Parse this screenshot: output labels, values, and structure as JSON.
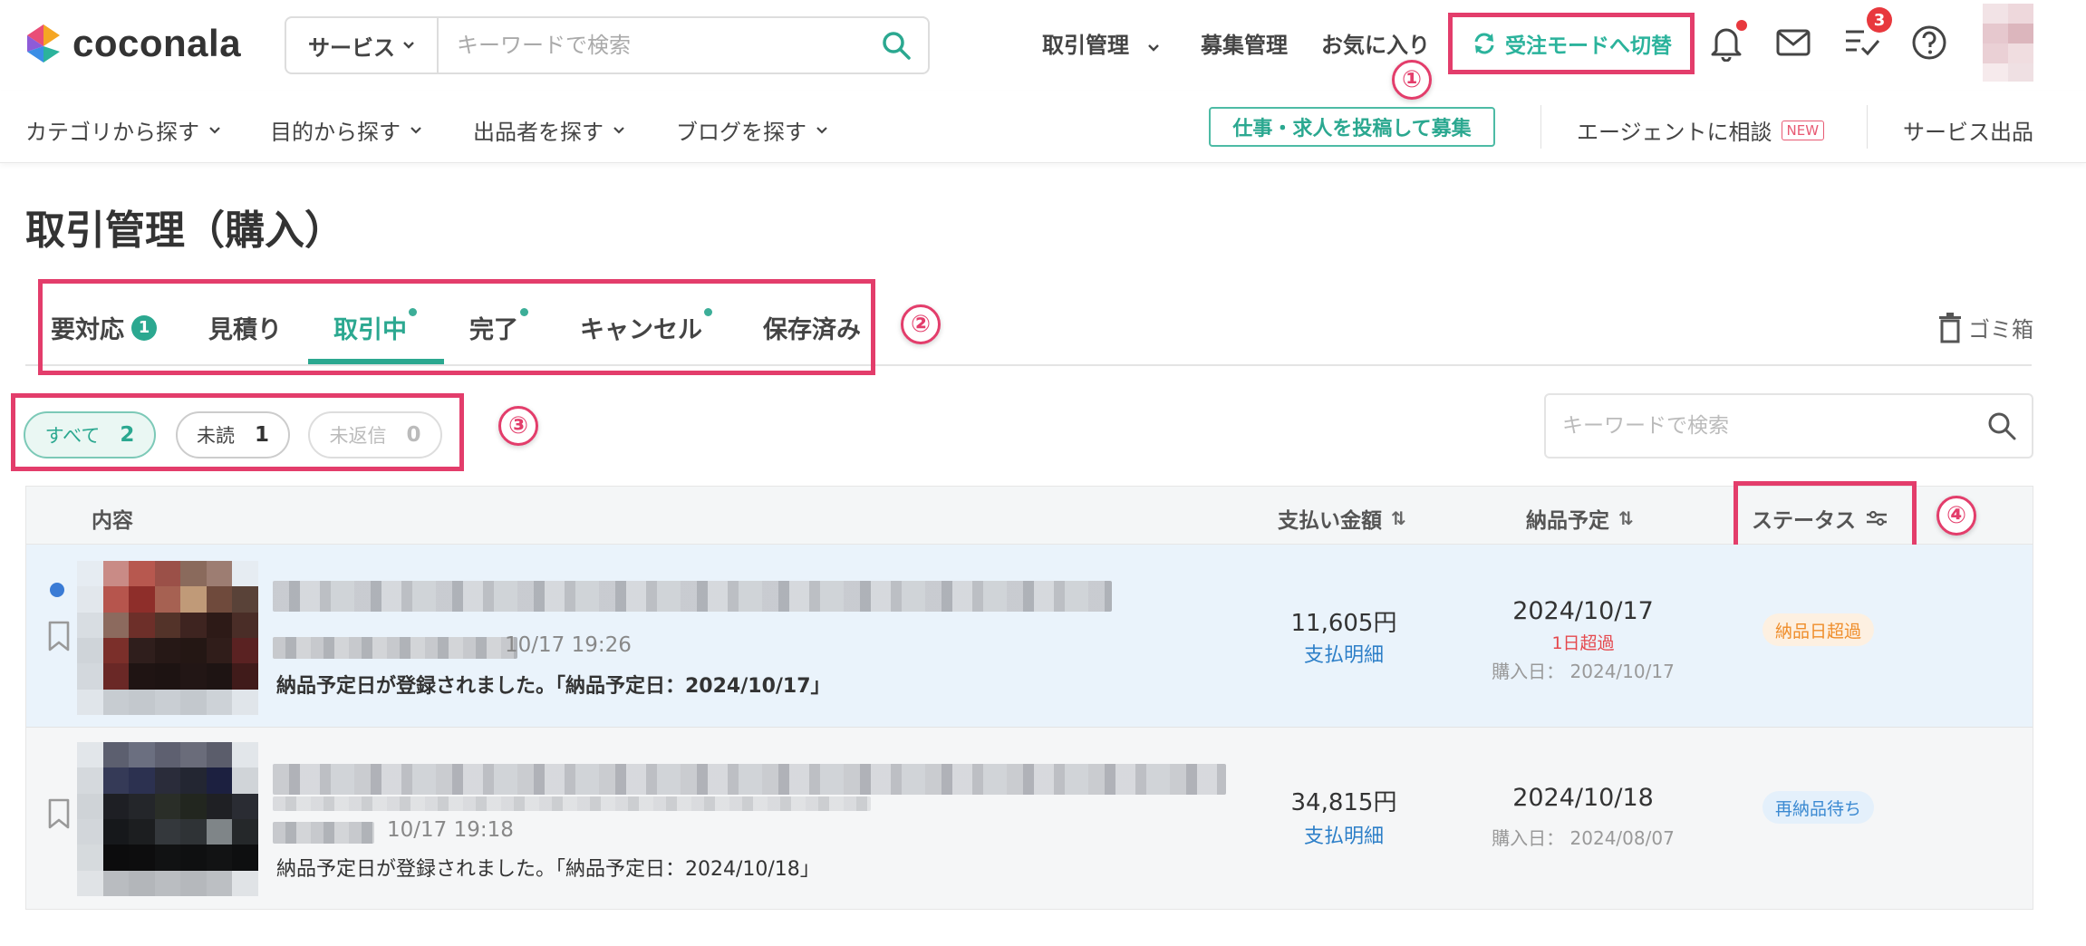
{
  "header": {
    "logo_text": "coconala",
    "search": {
      "category_label": "サービス",
      "placeholder": "キーワードで検索"
    },
    "nav": {
      "transactions": "取引管理",
      "recruitment": "募集管理",
      "favorites": "お気に入り",
      "mode_switch": "受注モードへ切替"
    },
    "todo_badge_count": "3"
  },
  "subnav": {
    "items": [
      "カテゴリから探す",
      "目的から探す",
      "出品者を探す",
      "ブログを探す"
    ],
    "post_job": "仕事・求人を投稿して募集",
    "agent": "エージェントに相談",
    "agent_badge": "NEW",
    "sell": "サービス出品"
  },
  "page": {
    "title": "取引管理（購入）"
  },
  "tabs": [
    {
      "label": "要対応",
      "count": "1"
    },
    {
      "label": "見積り"
    },
    {
      "label": "取引中"
    },
    {
      "label": "完了"
    },
    {
      "label": "キャンセル"
    },
    {
      "label": "保存済み"
    }
  ],
  "trash_label": "ゴミ箱",
  "filters": [
    {
      "label": "すべて",
      "count": "2"
    },
    {
      "label": "未読",
      "count": "1"
    },
    {
      "label": "未返信",
      "count": "0"
    }
  ],
  "keyword_search_placeholder": "キーワードで検索",
  "table": {
    "headers": {
      "content": "内容",
      "amount": "支払い金額",
      "due": "納品予定",
      "status": "ステータス"
    },
    "rows": [
      {
        "timestamp": "10/17 19:26",
        "message": "納品予定日が登録されました。「納品予定日：2024/10/17」",
        "amount": "11,605円",
        "pay_link": "支払明細",
        "due_date": "2024/10/17",
        "overdue": "1日超過",
        "purchase_date": "購入日： 2024/10/17",
        "status": "納品日超過"
      },
      {
        "timestamp": "10/17 19:18",
        "message": "納品予定日が登録されました。「納品予定日：2024/10/18」",
        "amount": "34,815円",
        "pay_link": "支払明細",
        "due_date": "2024/10/18",
        "purchase_date": "購入日： 2024/08/07",
        "status": "再納品待ち"
      }
    ]
  },
  "annotations": [
    "①",
    "②",
    "③",
    "④"
  ],
  "colors": {
    "brand_green": "#2ba890",
    "annotation_pink": "#e33d6b",
    "link_blue": "#2d7fc8",
    "overdue_red": "#e5484d",
    "status_orange": "#ef8d2a",
    "status_blue": "#3c8ad2"
  }
}
